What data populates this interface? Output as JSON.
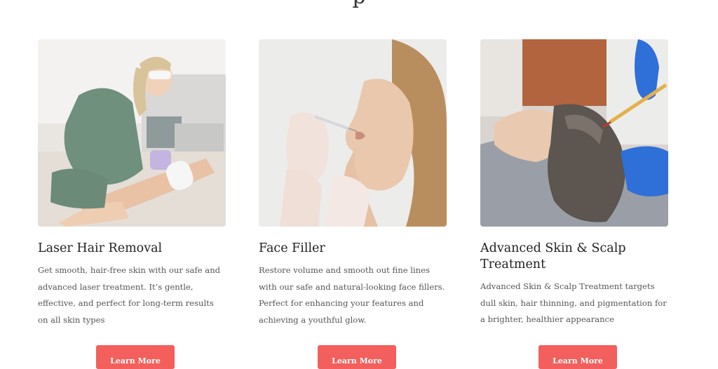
{
  "section": {
    "heading_fragment": "p"
  },
  "cards": [
    {
      "title": "Laser Hair Removal",
      "description": "Get smooth, hair-free skin with our safe and advanced laser treatment. It’s gentle, effective, and perfect for long-term results on all skin types",
      "button_label": "Learn More"
    },
    {
      "title": "Face Filler",
      "description": "Restore volume and smooth out fine lines with our safe and natural-looking face fillers. Perfect for enhancing your features and achieving a youthful glow.",
      "button_label": "Learn More"
    },
    {
      "title": "Advanced Skin & Scalp Treatment",
      "description": "Advanced Skin & Scalp Treatment targets dull skin, hair thinning, and pigmentation for a brighter, healthier appearance",
      "button_label": "Learn More"
    }
  ],
  "colors": {
    "button_bg": "#f25f5c",
    "button_text": "#ffffff"
  }
}
